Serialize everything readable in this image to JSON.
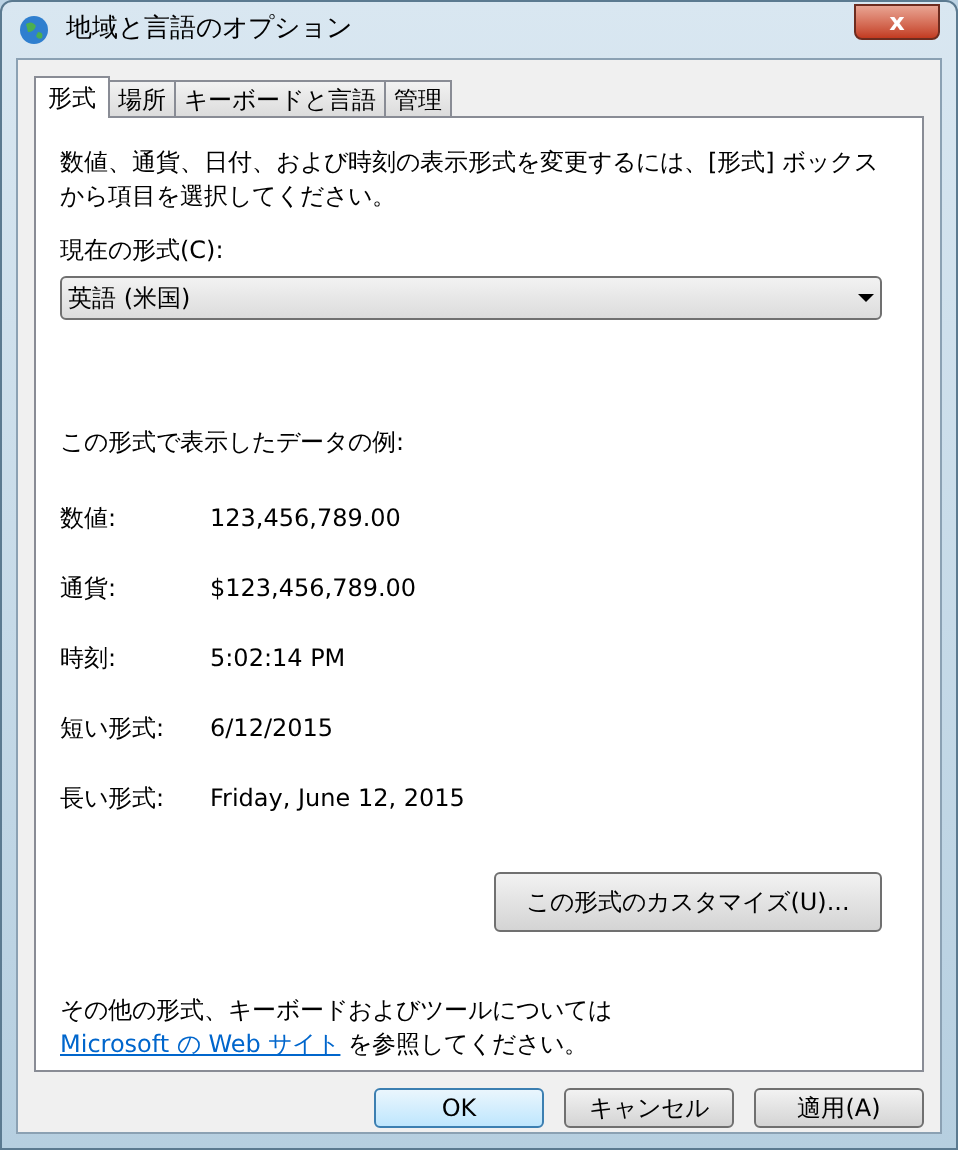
{
  "window": {
    "title": "地域と言語のオプション",
    "close": "x"
  },
  "tabs": [
    {
      "label": "形式",
      "selected": true
    },
    {
      "label": "場所",
      "selected": false
    },
    {
      "label": "キーボードと言語",
      "selected": false
    },
    {
      "label": "管理",
      "selected": false
    }
  ],
  "intro": "数値、通貨、日付、および時刻の表示形式を変更するには、[形式] ボックスから項目を選択してください。",
  "format_label": "現在の形式(C):",
  "format_dropdown": {
    "value": "英語 (米国)"
  },
  "examples_heading": "この形式で表示したデータの例:",
  "examples": [
    {
      "label": "数値:",
      "value": "123,456,789.00"
    },
    {
      "label": "通貨:",
      "value": "$123,456,789.00"
    },
    {
      "label": "時刻:",
      "value": "5:02:14 PM"
    },
    {
      "label": "短い形式:",
      "value": "6/12/2015"
    },
    {
      "label": "長い形式:",
      "value": "Friday, June 12, 2015"
    }
  ],
  "customize_button": "この形式のカスタマイズ(U)...",
  "footer": {
    "before": "その他の形式、キーボードおよびツールについては",
    "link": "Microsoft の Web サイト",
    "after": "を参照してください。"
  },
  "buttons": [
    {
      "label": "OK",
      "default": true
    },
    {
      "label": "キャンセル",
      "default": false
    },
    {
      "label": "適用(A)",
      "default": false
    }
  ]
}
